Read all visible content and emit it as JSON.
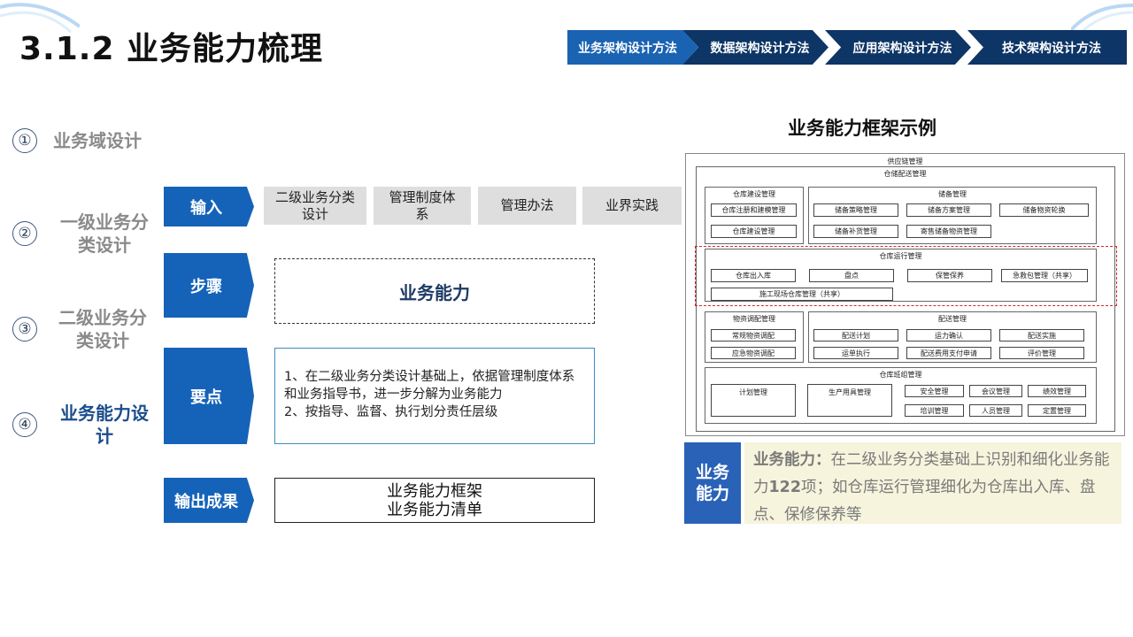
{
  "page": {
    "title": "3.1.2 业务能力梳理"
  },
  "nav": [
    {
      "label": "业务架构设计方法",
      "active": true
    },
    {
      "label": "数据架构设计方法",
      "active": false
    },
    {
      "label": "应用架构设计方法",
      "active": false
    },
    {
      "label": "技术架构设计方法",
      "active": false
    }
  ],
  "left_steps": [
    {
      "num": "①",
      "label": "业务域设计"
    },
    {
      "num": "②",
      "label": "一级业务分类设计"
    },
    {
      "num": "③",
      "label": "二级业务分类设计"
    },
    {
      "num": "④",
      "label": "业务能力设计"
    }
  ],
  "process": {
    "input_label": "输入",
    "inputs": [
      "二级业务分类设计",
      "管理制度体系",
      "管理办法",
      "业界实践"
    ],
    "step_label": "步骤",
    "step_content": "业务能力",
    "key_label": "要点",
    "key_points": [
      "1、在二级业务分类设计基础上，依据管理制度体系和业务指导书，进一步分解为业务能力",
      "2、按指导、监督、执行划分责任层级"
    ],
    "output_label": "输出成果",
    "outputs": [
      "业务能力框架",
      "业务能力清单"
    ]
  },
  "framework": {
    "title": "业务能力框架示例",
    "root": "供应链管理",
    "domain": "仓储配送管理",
    "groups": {
      "warehouse_build": {
        "title": "仓库建设管理",
        "items": [
          "仓库注册和建模管理",
          "仓库建设管理"
        ]
      },
      "reserve": {
        "title": "储备管理",
        "items": [
          "储备策略管理",
          "储备方案管理",
          "储备物资轮换",
          "储备补货管理",
          "寄售储备物资管理"
        ]
      },
      "warehouse_ops": {
        "title": "仓库运行管理",
        "items": [
          "仓库出入库",
          "盘点",
          "保管保养",
          "急救包管理（共享）",
          "施工现场仓库管理（共享）"
        ]
      },
      "allocation": {
        "title": "物资调配管理",
        "items": [
          "常规物资调配",
          "应急物资调配"
        ]
      },
      "delivery": {
        "title": "配送管理",
        "items": [
          "配送计划",
          "运力确认",
          "配送实施",
          "运单执行",
          "配送费用支付申请",
          "评价管理"
        ]
      },
      "team": {
        "title": "仓库班组管理",
        "items": [
          "计划管理",
          "生产用具管理",
          "安全管理",
          "会议管理",
          "绩效管理",
          "培训管理",
          "人员管理",
          "定置管理"
        ]
      }
    }
  },
  "callout": {
    "tag": "业务能力",
    "lead": "业务能力：",
    "text": "在二级业务分类基础上识别和细化业务能力",
    "count": "122",
    "text2": "项；如仓库运行管理细化为仓库出入库、盘点、保修保养等"
  }
}
